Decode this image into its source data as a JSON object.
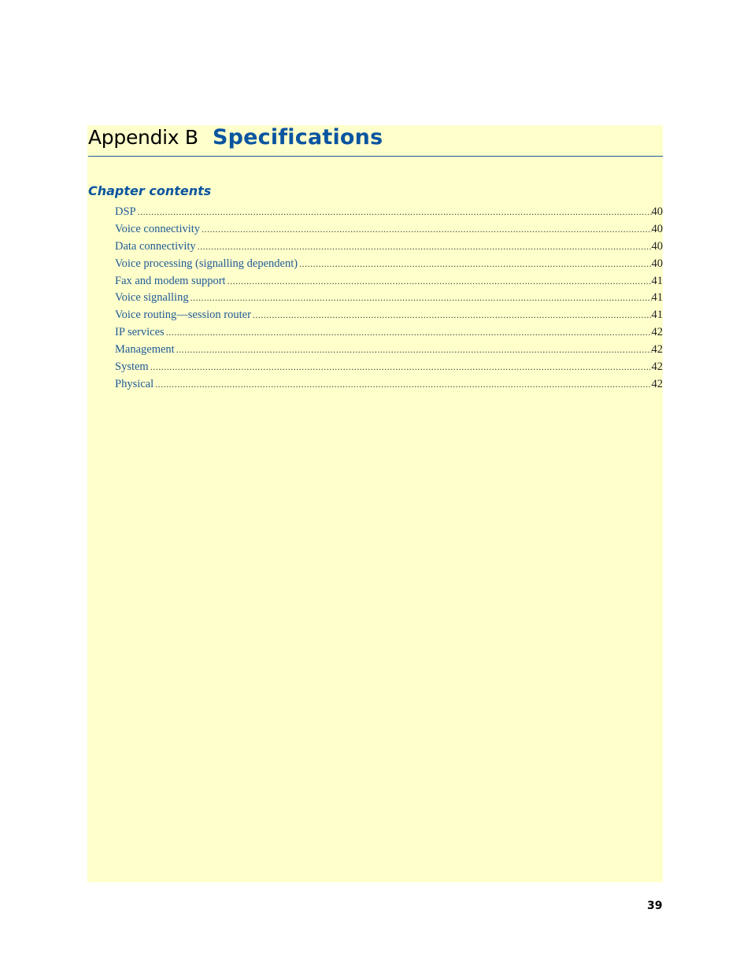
{
  "header": {
    "prefix": "Appendix B",
    "title": "Specifications"
  },
  "chapter_contents": {
    "heading": "Chapter contents",
    "entries": [
      {
        "label": "DSP",
        "page": "40"
      },
      {
        "label": "Voice connectivity",
        "page": "40"
      },
      {
        "label": "Data connectivity",
        "page": "40"
      },
      {
        "label": "Voice processing (signalling dependent)",
        "page": "40"
      },
      {
        "label": "Fax and modem support",
        "page": "41"
      },
      {
        "label": "Voice signalling",
        "page": "41"
      },
      {
        "label": "Voice routing—session router",
        "page": "41"
      },
      {
        "label": "IP services",
        "page": "42"
      },
      {
        "label": "Management",
        "page": "42"
      },
      {
        "label": "System",
        "page": "42"
      },
      {
        "label": "Physical",
        "page": "42"
      }
    ]
  },
  "footer": {
    "page_number": "39"
  },
  "colors": {
    "panel_background": "#ffffcc",
    "accent_blue": "#0b55a0",
    "link_blue": "#1f5a96"
  }
}
